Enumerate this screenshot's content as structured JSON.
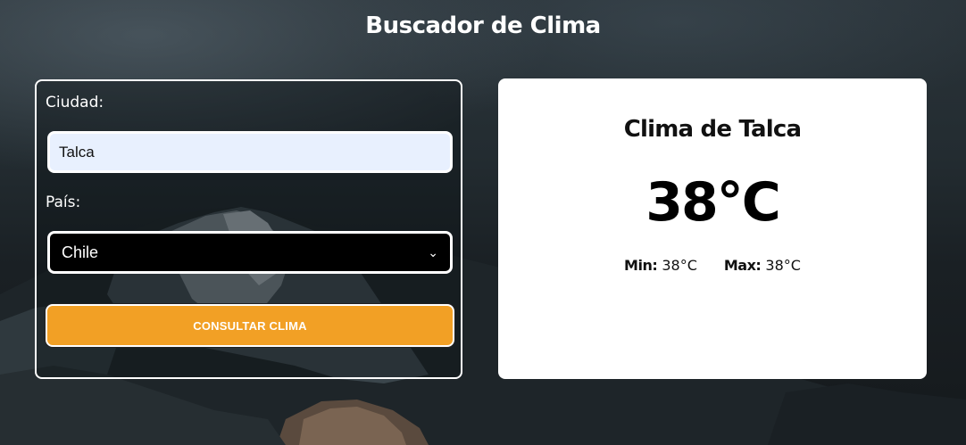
{
  "page": {
    "title": "Buscador de Clima"
  },
  "form": {
    "city_label": "Ciudad:",
    "city_value": "Talca",
    "country_label": "País:",
    "country_selected": "Chile",
    "submit_label": "CONSULTAR CLIMA"
  },
  "result": {
    "title": "Clima de Talca",
    "temperature": "38°C",
    "min_label": "Min:",
    "min_value": "38°C",
    "max_label": "Max:",
    "max_value": "38°C"
  },
  "colors": {
    "button": "#f2a025",
    "input_bg": "#e8f0fe",
    "select_bg": "#000000",
    "card_bg": "#ffffff"
  }
}
